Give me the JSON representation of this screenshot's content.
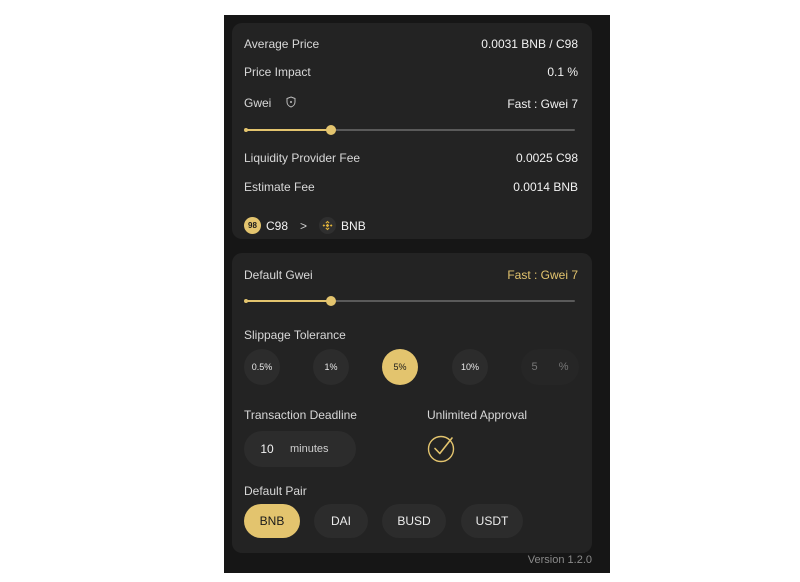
{
  "summary": {
    "average_price": {
      "label": "Average Price",
      "value": "0.0031 BNB / C98"
    },
    "price_impact": {
      "label": "Price Impact",
      "value": "0.1 %"
    },
    "gwei": {
      "label": "Gwei",
      "value": "Fast : Gwei 7",
      "slider_fraction": 0.26
    },
    "liquidity_fee": {
      "label": "Liquidity Provider Fee",
      "value": "0.0025 C98"
    },
    "estimate_fee": {
      "label": "Estimate Fee",
      "value": "0.0014 BNB"
    },
    "route": {
      "from": "C98",
      "from_badge": "98",
      "arrow": ">",
      "to": "BNB"
    }
  },
  "settings": {
    "default_gwei": {
      "label": "Default Gwei",
      "value": "Fast : Gwei 7",
      "slider_fraction": 0.26
    },
    "slippage": {
      "label": "Slippage Tolerance",
      "options": [
        "0.5%",
        "1%",
        "5%",
        "10%"
      ],
      "selected": "5%",
      "custom_placeholder": "5",
      "custom_unit": "%"
    },
    "deadline": {
      "label": "Transaction Deadline",
      "value": "10",
      "unit": "minutes"
    },
    "unlimited_approval": {
      "label": "Unlimited Approval",
      "checked": true
    },
    "default_pair": {
      "label": "Default Pair",
      "options": [
        "BNB",
        "DAI",
        "BUSD",
        "USDT"
      ],
      "selected": "BNB"
    }
  },
  "footer": {
    "version": "Version 1.2.0"
  },
  "colors": {
    "accent": "#e3c46e",
    "panel": "#161616",
    "card": "#232323"
  }
}
